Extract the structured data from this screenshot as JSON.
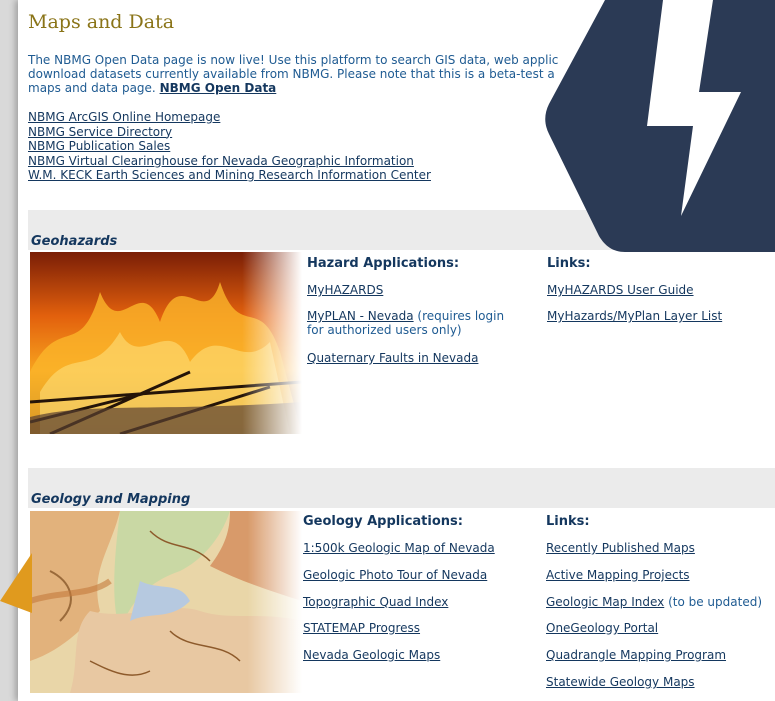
{
  "page": {
    "title": "Maps and Data",
    "intro_line1": "The NBMG Open Data page is now live! Use this platform to search GIS data, web applic",
    "intro_line2": "download datasets currently available from NBMG. Please note that this is a beta-test a",
    "intro_line3": "maps and data page.",
    "open_data_link": "NBMG Open Data"
  },
  "links": [
    "NBMG ArcGIS Online Homepage",
    "NBMG Service Directory",
    "NBMG Publication Sales",
    "NBMG Virtual Clearinghouse for Nevada Geographic Information",
    "W.M. KECK Earth Sciences and Mining Research Information Center"
  ],
  "geohazards": {
    "title": "Geohazards",
    "apps_heading": "Hazard Applications:",
    "links_heading": "Links:",
    "apps": [
      {
        "label": "MyHAZARDS",
        "note": ""
      },
      {
        "label": "MyPLAN - Nevada",
        "note": "(requires login",
        "note2": "for authorized users only)"
      },
      {
        "label": "Quaternary Faults in Nevada",
        "note": ""
      }
    ],
    "links": [
      "MyHAZARDS User Guide",
      "MyHazards/MyPlan Layer List"
    ]
  },
  "geology": {
    "title": "Geology and Mapping",
    "apps_heading": "Geology Applications:",
    "links_heading": "Links:",
    "apps": [
      "1:500k Geologic Map of Nevada",
      "Geologic Photo Tour of Nevada",
      "Topographic Quad Index",
      "STATEMAP Progress",
      "Nevada Geologic Maps"
    ],
    "links": [
      {
        "label": "Recently Published Maps",
        "note": ""
      },
      {
        "label": "Active Mapping Projects",
        "note": ""
      },
      {
        "label": "Geologic Map Index",
        "note": "(to be updated)"
      },
      {
        "label": "OneGeology Portal",
        "note": ""
      },
      {
        "label": "Quadrangle Mapping Program",
        "note": ""
      },
      {
        "label": "Statewide Geology Maps",
        "note": ""
      }
    ]
  },
  "colors": {
    "title": "#8a7418",
    "link": "#14375e",
    "badge": "#2b3a55",
    "triangle": "#e09a1e"
  },
  "icons": {
    "badge": "lightning-bolt-icon",
    "corner": "orange-triangle-icon"
  }
}
